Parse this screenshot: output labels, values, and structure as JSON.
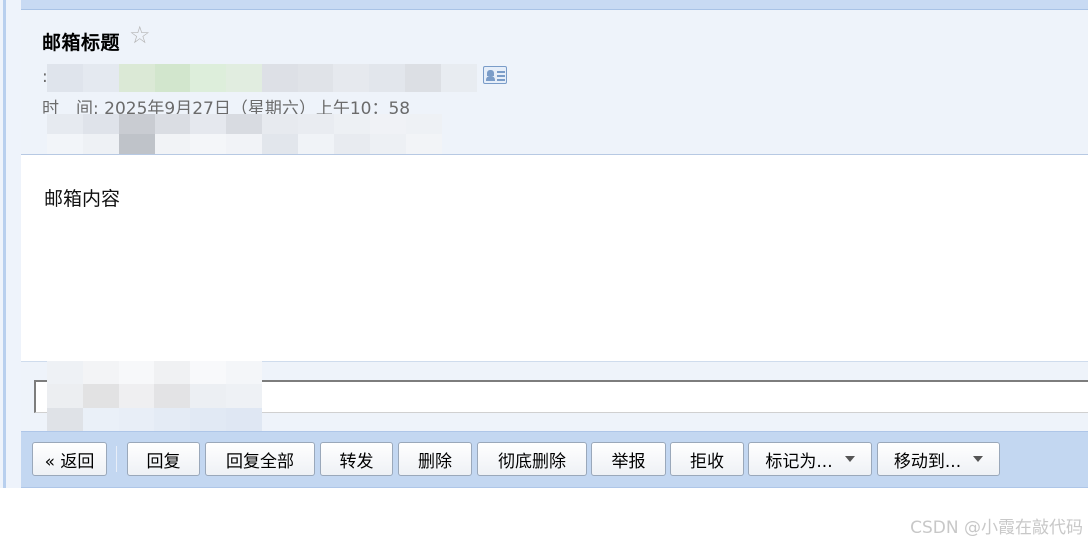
{
  "mail": {
    "subject": "邮箱标题",
    "star": "☆",
    "sender_prefix": ":",
    "time_label": "时　间:",
    "time_value": "2025年9月27日（星期六）上午10：58",
    "body": "邮箱内容"
  },
  "toolbar": {
    "back": "« 返回",
    "reply": "回复",
    "reply_all": "回复全部",
    "forward": "转发",
    "delete": "删除",
    "delete_permanent": "彻底删除",
    "report": "举报",
    "reject": "拒收",
    "mark_as": "标记为...",
    "move_to": "移动到..."
  },
  "watermark": "CSDN @小霞在敲代码",
  "colors": {
    "header_bg": "#eef3fa",
    "toolbar_bg": "#c3d7f1",
    "button_border": "#9aa8ba"
  }
}
